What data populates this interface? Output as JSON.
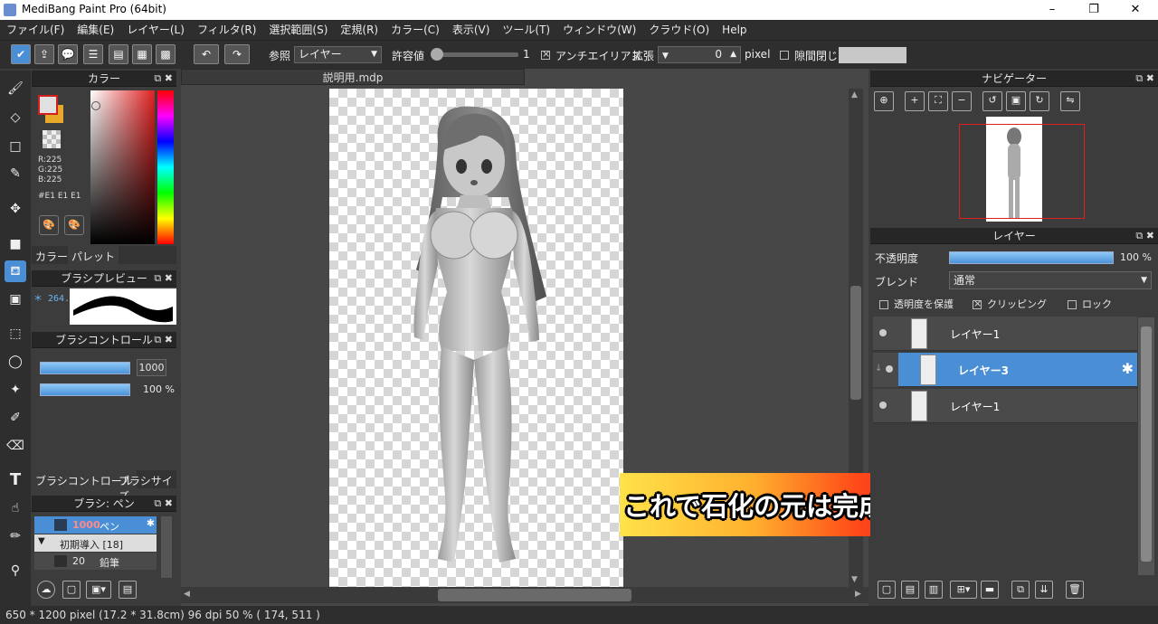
{
  "window": {
    "title": "MediBang Paint Pro (64bit)",
    "minimize": "–",
    "restore": "❐",
    "close": "✕"
  },
  "menu": [
    "ファイル(F)",
    "編集(E)",
    "レイヤー(L)",
    "フィルタ(R)",
    "選択範囲(S)",
    "定規(R)",
    "カラー(C)",
    "表示(V)",
    "ツール(T)",
    "ウィンドウ(W)",
    "クラウド(O)",
    "Help"
  ],
  "toolbar": {
    "ref_label": "参照",
    "ref_value": "レイヤー",
    "tolerance_label": "許容値",
    "tolerance_value": "1",
    "antialias_label": "アンチエイリアス",
    "expand_label": "拡張",
    "expand_value": "0",
    "expand_unit": "pixel",
    "gap_close_label": "隙間閉じ"
  },
  "color_panel": {
    "title": "カラー",
    "r": "R:225",
    "g": "G:225",
    "b": "B:225",
    "hex": "#E1 E1 E1",
    "tab_color": "カラー",
    "tab_palette": "パレット",
    "foreground": "#e1e1e1",
    "background": "#e8a82a"
  },
  "brush_preview": {
    "title": "ブラシプレビュー",
    "size": "＊ 264.5"
  },
  "brush_control": {
    "title": "ブラシコントロール",
    "size_value": "1000",
    "opacity_value": "100 %",
    "size_fraction": 1.0,
    "opacity_fraction": 1.0,
    "tab_control": "ブラシコントロール",
    "tab_size": "ブラシサイズ"
  },
  "brush_list": {
    "title": "ブラシ: ペン",
    "items": [
      {
        "size": "1000",
        "name": "ペン"
      },
      {
        "group": "初期導入 [18]"
      },
      {
        "size": "20",
        "name": "鉛筆"
      }
    ]
  },
  "document": {
    "tab": "説明用.mdp"
  },
  "banner_text": "これで石化の元は完成！",
  "navigator": {
    "title": "ナビゲーター"
  },
  "layers": {
    "title": "レイヤー",
    "opacity_label": "不透明度",
    "opacity_value": "100 %",
    "opacity_fraction": 1.0,
    "blend_label": "ブレンド",
    "blend_value": "通常",
    "protect_alpha": "透明度を保護",
    "clipping": "クリッピング",
    "lock": "ロック",
    "items": [
      {
        "name": "レイヤー1",
        "selected": false
      },
      {
        "name": "レイヤー3",
        "selected": true
      },
      {
        "name": "レイヤー1",
        "selected": false
      }
    ]
  },
  "status": {
    "text": "650 * 1200 pixel   (17.2 * 31.8cm)   96 dpi   50 %   ( 174, 511 )"
  },
  "colors": {
    "accent": "#4a8fd6"
  }
}
